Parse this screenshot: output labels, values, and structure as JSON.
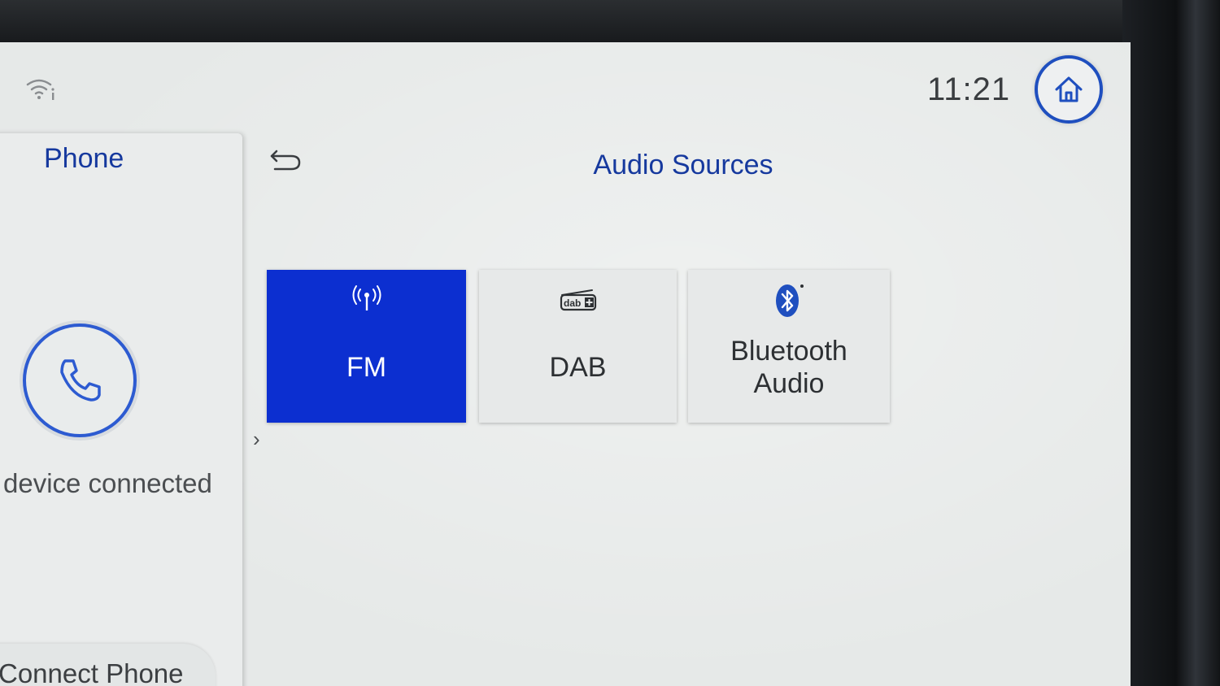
{
  "status_bar": {
    "time": "11:21",
    "wifi_icon": "wifi-info-icon",
    "home_icon": "home-icon"
  },
  "side_panel": {
    "title": "Phone",
    "phone_icon": "phone-handset-icon",
    "status": "device connected",
    "connect_label": "Connect Phone"
  },
  "main": {
    "title": "Audio Sources",
    "back_icon": "back-arrow-icon",
    "expand_chevron": "›",
    "sources": [
      {
        "label": "FM",
        "icon": "radio-antenna-icon",
        "selected": true
      },
      {
        "label": "DAB",
        "icon": "dab-plus-icon",
        "selected": false
      },
      {
        "label": "Bluetooth Audio",
        "label_line1": "Bluetooth",
        "label_line2": "Audio",
        "icon": "bluetooth-icon",
        "selected": false
      }
    ]
  },
  "colors": {
    "accent_blue": "#16399e",
    "selected_tile": "#0c2fd0",
    "screen_bg": "#e6e9e8"
  }
}
